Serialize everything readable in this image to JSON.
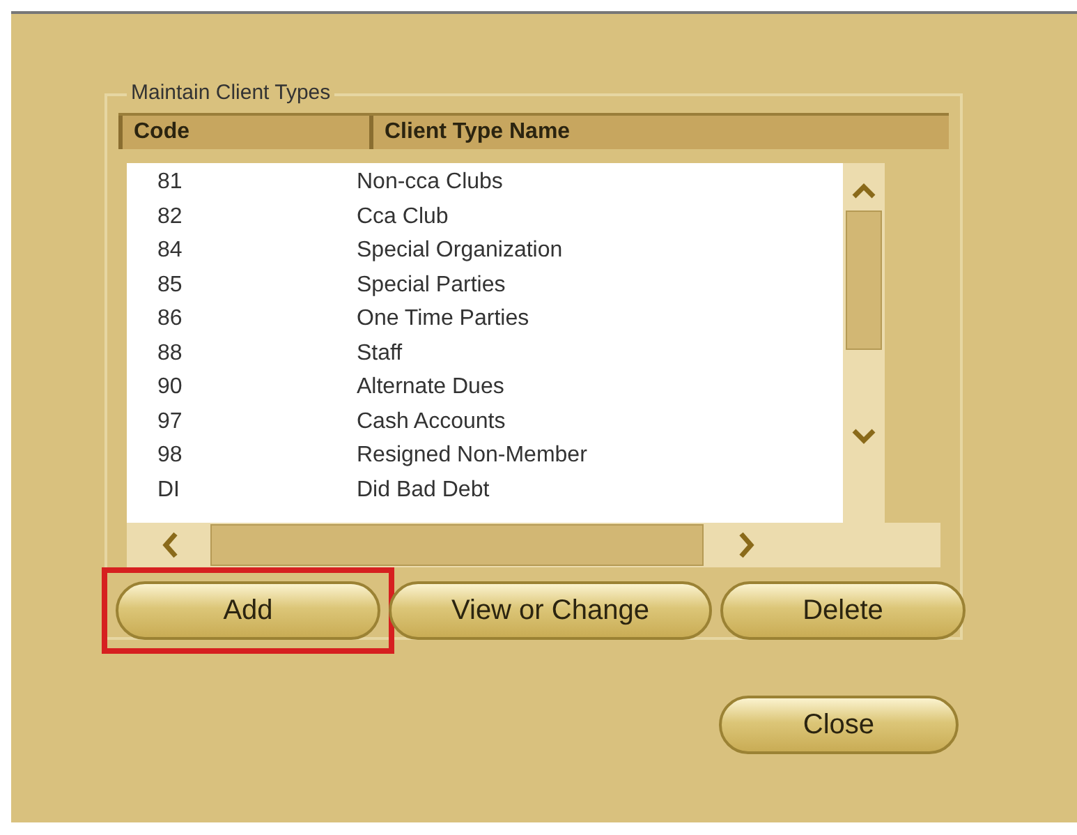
{
  "group": {
    "title": "Maintain Client Types",
    "columns": [
      "Code",
      "Client Type Name"
    ],
    "rows": [
      {
        "code": "81",
        "name": "Non-cca Clubs"
      },
      {
        "code": "82",
        "name": "Cca Club"
      },
      {
        "code": "84",
        "name": "Special Organization"
      },
      {
        "code": "85",
        "name": "Special Parties"
      },
      {
        "code": "86",
        "name": "One Time Parties"
      },
      {
        "code": "88",
        "name": "Staff"
      },
      {
        "code": "90",
        "name": "Alternate Dues"
      },
      {
        "code": "97",
        "name": "Cash Accounts"
      },
      {
        "code": "98",
        "name": "Resigned Non-Member"
      },
      {
        "code": "DI",
        "name": "Did Bad Debt"
      }
    ],
    "buttons": [
      {
        "label": "Add",
        "highlighted": true
      },
      {
        "label": "View or Change",
        "highlighted": false
      },
      {
        "label": "Delete",
        "highlighted": false
      }
    ]
  },
  "close_button": {
    "label": "Close"
  }
}
